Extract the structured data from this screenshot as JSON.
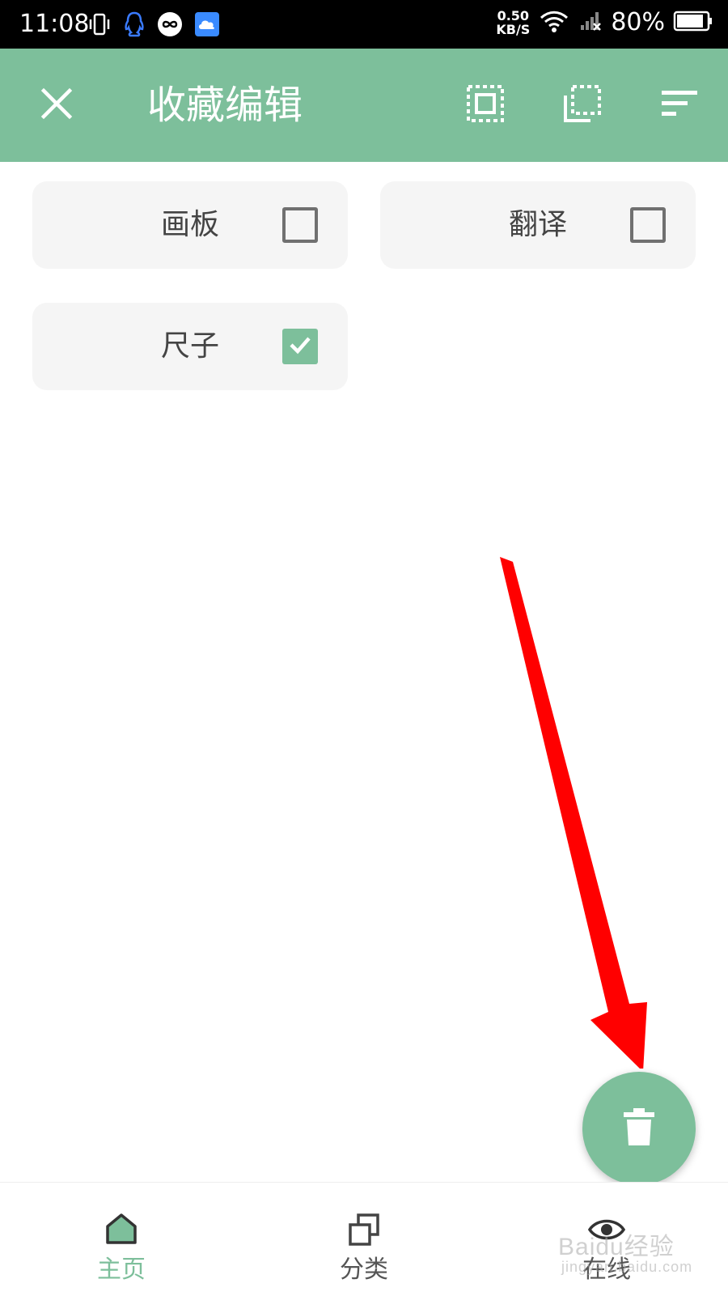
{
  "status_bar": {
    "time": "11:08",
    "net_speed_value": "0.50",
    "net_speed_unit": "KB/S",
    "battery_percent": "80%"
  },
  "app_bar": {
    "title": "收藏编辑",
    "icons": [
      "close-icon",
      "select-all-icon",
      "select-inverse-icon",
      "sort-icon"
    ]
  },
  "items": [
    {
      "label": "画板",
      "checked": false
    },
    {
      "label": "翻译",
      "checked": false
    },
    {
      "label": "尺子",
      "checked": true
    }
  ],
  "fab": {
    "icon": "trash-icon"
  },
  "bottom_nav": {
    "items": [
      {
        "label": "主页",
        "icon": "home-icon",
        "active": true
      },
      {
        "label": "分类",
        "icon": "category-icon",
        "active": false
      },
      {
        "label": "在线",
        "icon": "eye-icon",
        "active": false
      }
    ]
  },
  "watermark": {
    "text": "Baidu经验",
    "sub": "jingyan.baidu.com"
  },
  "colors": {
    "accent": "#7dbf9b",
    "status_bar": "#000000",
    "card_bg": "#f5f5f5",
    "arrow": "#ff0000"
  }
}
